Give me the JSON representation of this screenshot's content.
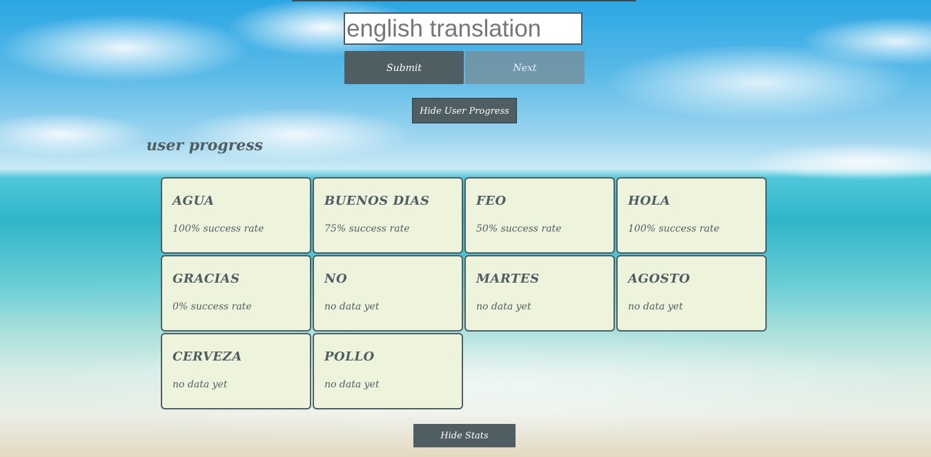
{
  "quiz": {
    "input_placeholder": "english translation",
    "submit_label": "Submit",
    "next_label": "Next",
    "hide_progress_label": "Hide User Progress"
  },
  "progress": {
    "title": "user progress",
    "cards": [
      {
        "word": "AGUA",
        "stat": "100% success rate"
      },
      {
        "word": "BUENOS DIAS",
        "stat": "75% success rate"
      },
      {
        "word": "FEO",
        "stat": "50% success rate"
      },
      {
        "word": "HOLA",
        "stat": "100% success rate"
      },
      {
        "word": "GRACIAS",
        "stat": "0% success rate"
      },
      {
        "word": "NO",
        "stat": "no data yet"
      },
      {
        "word": "MARTES",
        "stat": "no data yet"
      },
      {
        "word": "AGOSTO",
        "stat": "no data yet"
      },
      {
        "word": "CERVEZA",
        "stat": "no data yet"
      },
      {
        "word": "POLLO",
        "stat": "no data yet"
      }
    ]
  },
  "footer": {
    "hide_stats_label": "Hide Stats"
  },
  "colors": {
    "primary": "#4f5e62",
    "card_background": "#eef4dc"
  }
}
